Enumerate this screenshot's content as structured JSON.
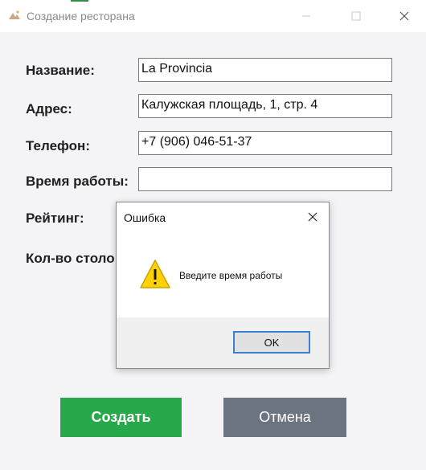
{
  "window": {
    "title": "Создание ресторана"
  },
  "form": {
    "name_label": "Название:",
    "name_value": "La Provincia",
    "address_label": "Адрес:",
    "address_value": "Калужская площадь, 1, стр. 4",
    "phone_label": "Телефон:",
    "phone_value": "+7 (906) 046-51-37",
    "hours_label": "Время работы:",
    "hours_value": "",
    "rating_label": "Рейтинг:",
    "tables_label": "Кол-во столо"
  },
  "buttons": {
    "create": "Создать",
    "cancel": "Отмена"
  },
  "dialog": {
    "title": "Ошибка",
    "message": "Введите время работы",
    "ok": "OK"
  },
  "colors": {
    "create_button": "#27a84b",
    "cancel_button": "#6b7480",
    "warning_icon": "#ffd200"
  }
}
